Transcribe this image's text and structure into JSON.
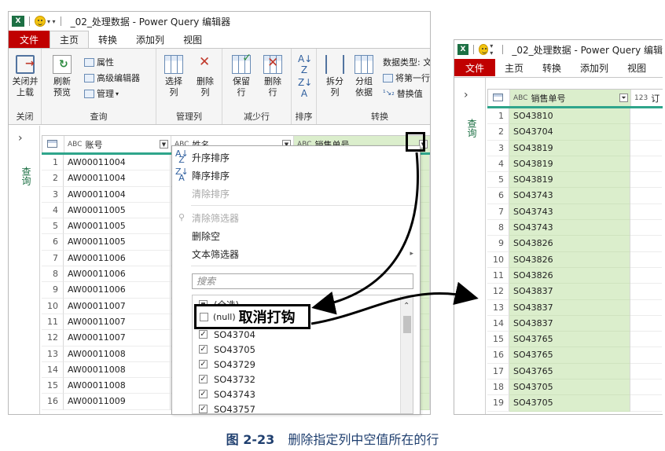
{
  "window_left": {
    "title": "_02_处理数据 - Power Query 编辑器",
    "tabs": [
      "文件",
      "主页",
      "转换",
      "添加列",
      "视图"
    ],
    "active_tab": "主页",
    "ribbon": {
      "close_load": "关闭并\n上载",
      "refresh_preview": "刷新\n预览",
      "properties": "属性",
      "advanced_editor": "高级编辑器",
      "manage": "管理",
      "choose_columns": "选择\n列",
      "remove_columns": "删除\n列",
      "keep_rows": "保留\n行",
      "remove_rows": "删除\n行",
      "split_column": "拆分\n列",
      "group_by": "分组\n依据",
      "data_type": "数据类型: 文",
      "use_first_row": "将第一行",
      "replace_values": "替换值",
      "groups": [
        "关闭",
        "查询",
        "管理列",
        "减少行",
        "排序",
        "转换"
      ]
    },
    "query_pane_label": "查询",
    "columns": [
      "账号",
      "姓名",
      "销售单号"
    ],
    "column_type_label": "ABC",
    "rows": [
      {
        "n": "1",
        "account": "AW00011004"
      },
      {
        "n": "2",
        "account": "AW00011004"
      },
      {
        "n": "3",
        "account": "AW00011004"
      },
      {
        "n": "4",
        "account": "AW00011005"
      },
      {
        "n": "5",
        "account": "AW00011005"
      },
      {
        "n": "6",
        "account": "AW00011005"
      },
      {
        "n": "7",
        "account": "AW00011006"
      },
      {
        "n": "8",
        "account": "AW00011006"
      },
      {
        "n": "9",
        "account": "AW00011006"
      },
      {
        "n": "10",
        "account": "AW00011007"
      },
      {
        "n": "11",
        "account": "AW00011007"
      },
      {
        "n": "12",
        "account": "AW00011007"
      },
      {
        "n": "13",
        "account": "AW00011008"
      },
      {
        "n": "14",
        "account": "AW00011008"
      },
      {
        "n": "15",
        "account": "AW00011008"
      },
      {
        "n": "16",
        "account": "AW00011009"
      }
    ]
  },
  "filter_menu": {
    "sort_asc": "升序排序",
    "sort_desc": "降序排序",
    "clear_sort": "清除排序",
    "clear_filter": "清除筛选器",
    "remove_empty": "删除空",
    "text_filters": "文本筛选器",
    "search_placeholder": "搜索",
    "items": [
      {
        "label": "(全选)",
        "state": "partial"
      },
      {
        "label": "(null)",
        "state": "unchecked"
      },
      {
        "label": "SO43704",
        "state": "checked"
      },
      {
        "label": "SO43705",
        "state": "checked"
      },
      {
        "label": "SO43729",
        "state": "checked"
      },
      {
        "label": "SO43732",
        "state": "checked"
      },
      {
        "label": "SO43743",
        "state": "checked"
      },
      {
        "label": "SO43757",
        "state": "checked"
      }
    ]
  },
  "callout": {
    "null_label": "(null)",
    "text": "取消打钩"
  },
  "window_right": {
    "title": "_02_处理数据 - Power Query 编辑",
    "tabs": [
      "文件",
      "主页",
      "转换",
      "添加列",
      "视图"
    ],
    "query_pane_label": "查询",
    "column": "销售单号",
    "next_column_stub": "订",
    "rows": [
      {
        "n": "1",
        "v": "SO43810"
      },
      {
        "n": "2",
        "v": "SO43704"
      },
      {
        "n": "3",
        "v": "SO43819"
      },
      {
        "n": "4",
        "v": "SO43819"
      },
      {
        "n": "5",
        "v": "SO43819"
      },
      {
        "n": "6",
        "v": "SO43743"
      },
      {
        "n": "7",
        "v": "SO43743"
      },
      {
        "n": "8",
        "v": "SO43743"
      },
      {
        "n": "9",
        "v": "SO43826"
      },
      {
        "n": "10",
        "v": "SO43826"
      },
      {
        "n": "11",
        "v": "SO43826"
      },
      {
        "n": "12",
        "v": "SO43837"
      },
      {
        "n": "13",
        "v": "SO43837"
      },
      {
        "n": "14",
        "v": "SO43837"
      },
      {
        "n": "15",
        "v": "SO43765"
      },
      {
        "n": "16",
        "v": "SO43765"
      },
      {
        "n": "17",
        "v": "SO43765"
      },
      {
        "n": "18",
        "v": "SO43705"
      },
      {
        "n": "19",
        "v": "SO43705"
      }
    ]
  },
  "caption": {
    "figure": "图 2-23",
    "text": "删除指定列中空值所在的行"
  },
  "colors": {
    "file_tab": "#c00000",
    "selected_column": "#dbeecc",
    "header_bar": "#2fa58b",
    "excel_green": "#1d7044",
    "caption": "#1f3f6f"
  }
}
